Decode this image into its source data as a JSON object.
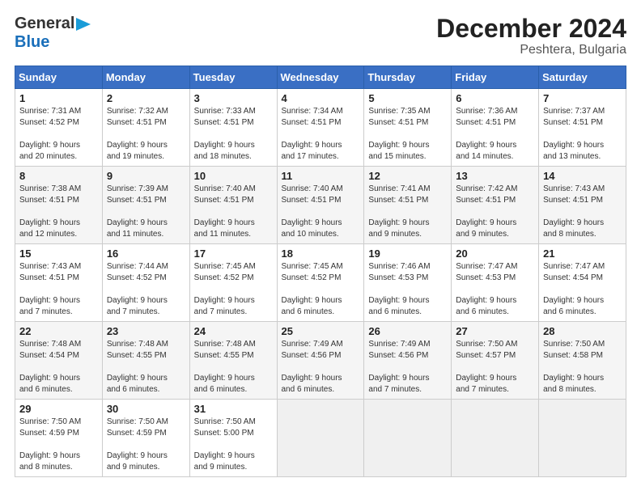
{
  "header": {
    "logo_general": "General",
    "logo_blue": "Blue",
    "title": "December 2024",
    "subtitle": "Peshtera, Bulgaria"
  },
  "days_of_week": [
    "Sunday",
    "Monday",
    "Tuesday",
    "Wednesday",
    "Thursday",
    "Friday",
    "Saturday"
  ],
  "weeks": [
    [
      {
        "day": "1",
        "sunrise": "7:31 AM",
        "sunset": "4:52 PM",
        "daylight": "9 hours and 20 minutes."
      },
      {
        "day": "2",
        "sunrise": "7:32 AM",
        "sunset": "4:51 PM",
        "daylight": "9 hours and 19 minutes."
      },
      {
        "day": "3",
        "sunrise": "7:33 AM",
        "sunset": "4:51 PM",
        "daylight": "9 hours and 18 minutes."
      },
      {
        "day": "4",
        "sunrise": "7:34 AM",
        "sunset": "4:51 PM",
        "daylight": "9 hours and 17 minutes."
      },
      {
        "day": "5",
        "sunrise": "7:35 AM",
        "sunset": "4:51 PM",
        "daylight": "9 hours and 15 minutes."
      },
      {
        "day": "6",
        "sunrise": "7:36 AM",
        "sunset": "4:51 PM",
        "daylight": "9 hours and 14 minutes."
      },
      {
        "day": "7",
        "sunrise": "7:37 AM",
        "sunset": "4:51 PM",
        "daylight": "9 hours and 13 minutes."
      }
    ],
    [
      {
        "day": "8",
        "sunrise": "7:38 AM",
        "sunset": "4:51 PM",
        "daylight": "9 hours and 12 minutes."
      },
      {
        "day": "9",
        "sunrise": "7:39 AM",
        "sunset": "4:51 PM",
        "daylight": "9 hours and 11 minutes."
      },
      {
        "day": "10",
        "sunrise": "7:40 AM",
        "sunset": "4:51 PM",
        "daylight": "9 hours and 11 minutes."
      },
      {
        "day": "11",
        "sunrise": "7:40 AM",
        "sunset": "4:51 PM",
        "daylight": "9 hours and 10 minutes."
      },
      {
        "day": "12",
        "sunrise": "7:41 AM",
        "sunset": "4:51 PM",
        "daylight": "9 hours and 9 minutes."
      },
      {
        "day": "13",
        "sunrise": "7:42 AM",
        "sunset": "4:51 PM",
        "daylight": "9 hours and 9 minutes."
      },
      {
        "day": "14",
        "sunrise": "7:43 AM",
        "sunset": "4:51 PM",
        "daylight": "9 hours and 8 minutes."
      }
    ],
    [
      {
        "day": "15",
        "sunrise": "7:43 AM",
        "sunset": "4:51 PM",
        "daylight": "9 hours and 7 minutes."
      },
      {
        "day": "16",
        "sunrise": "7:44 AM",
        "sunset": "4:52 PM",
        "daylight": "9 hours and 7 minutes."
      },
      {
        "day": "17",
        "sunrise": "7:45 AM",
        "sunset": "4:52 PM",
        "daylight": "9 hours and 7 minutes."
      },
      {
        "day": "18",
        "sunrise": "7:45 AM",
        "sunset": "4:52 PM",
        "daylight": "9 hours and 6 minutes."
      },
      {
        "day": "19",
        "sunrise": "7:46 AM",
        "sunset": "4:53 PM",
        "daylight": "9 hours and 6 minutes."
      },
      {
        "day": "20",
        "sunrise": "7:47 AM",
        "sunset": "4:53 PM",
        "daylight": "9 hours and 6 minutes."
      },
      {
        "day": "21",
        "sunrise": "7:47 AM",
        "sunset": "4:54 PM",
        "daylight": "9 hours and 6 minutes."
      }
    ],
    [
      {
        "day": "22",
        "sunrise": "7:48 AM",
        "sunset": "4:54 PM",
        "daylight": "9 hours and 6 minutes."
      },
      {
        "day": "23",
        "sunrise": "7:48 AM",
        "sunset": "4:55 PM",
        "daylight": "9 hours and 6 minutes."
      },
      {
        "day": "24",
        "sunrise": "7:48 AM",
        "sunset": "4:55 PM",
        "daylight": "9 hours and 6 minutes."
      },
      {
        "day": "25",
        "sunrise": "7:49 AM",
        "sunset": "4:56 PM",
        "daylight": "9 hours and 6 minutes."
      },
      {
        "day": "26",
        "sunrise": "7:49 AM",
        "sunset": "4:56 PM",
        "daylight": "9 hours and 7 minutes."
      },
      {
        "day": "27",
        "sunrise": "7:50 AM",
        "sunset": "4:57 PM",
        "daylight": "9 hours and 7 minutes."
      },
      {
        "day": "28",
        "sunrise": "7:50 AM",
        "sunset": "4:58 PM",
        "daylight": "9 hours and 8 minutes."
      }
    ],
    [
      {
        "day": "29",
        "sunrise": "7:50 AM",
        "sunset": "4:59 PM",
        "daylight": "9 hours and 8 minutes."
      },
      {
        "day": "30",
        "sunrise": "7:50 AM",
        "sunset": "4:59 PM",
        "daylight": "9 hours and 9 minutes."
      },
      {
        "day": "31",
        "sunrise": "7:50 AM",
        "sunset": "5:00 PM",
        "daylight": "9 hours and 9 minutes."
      },
      null,
      null,
      null,
      null
    ]
  ],
  "labels": {
    "sunrise": "Sunrise:",
    "sunset": "Sunset:",
    "daylight": "Daylight hours"
  }
}
